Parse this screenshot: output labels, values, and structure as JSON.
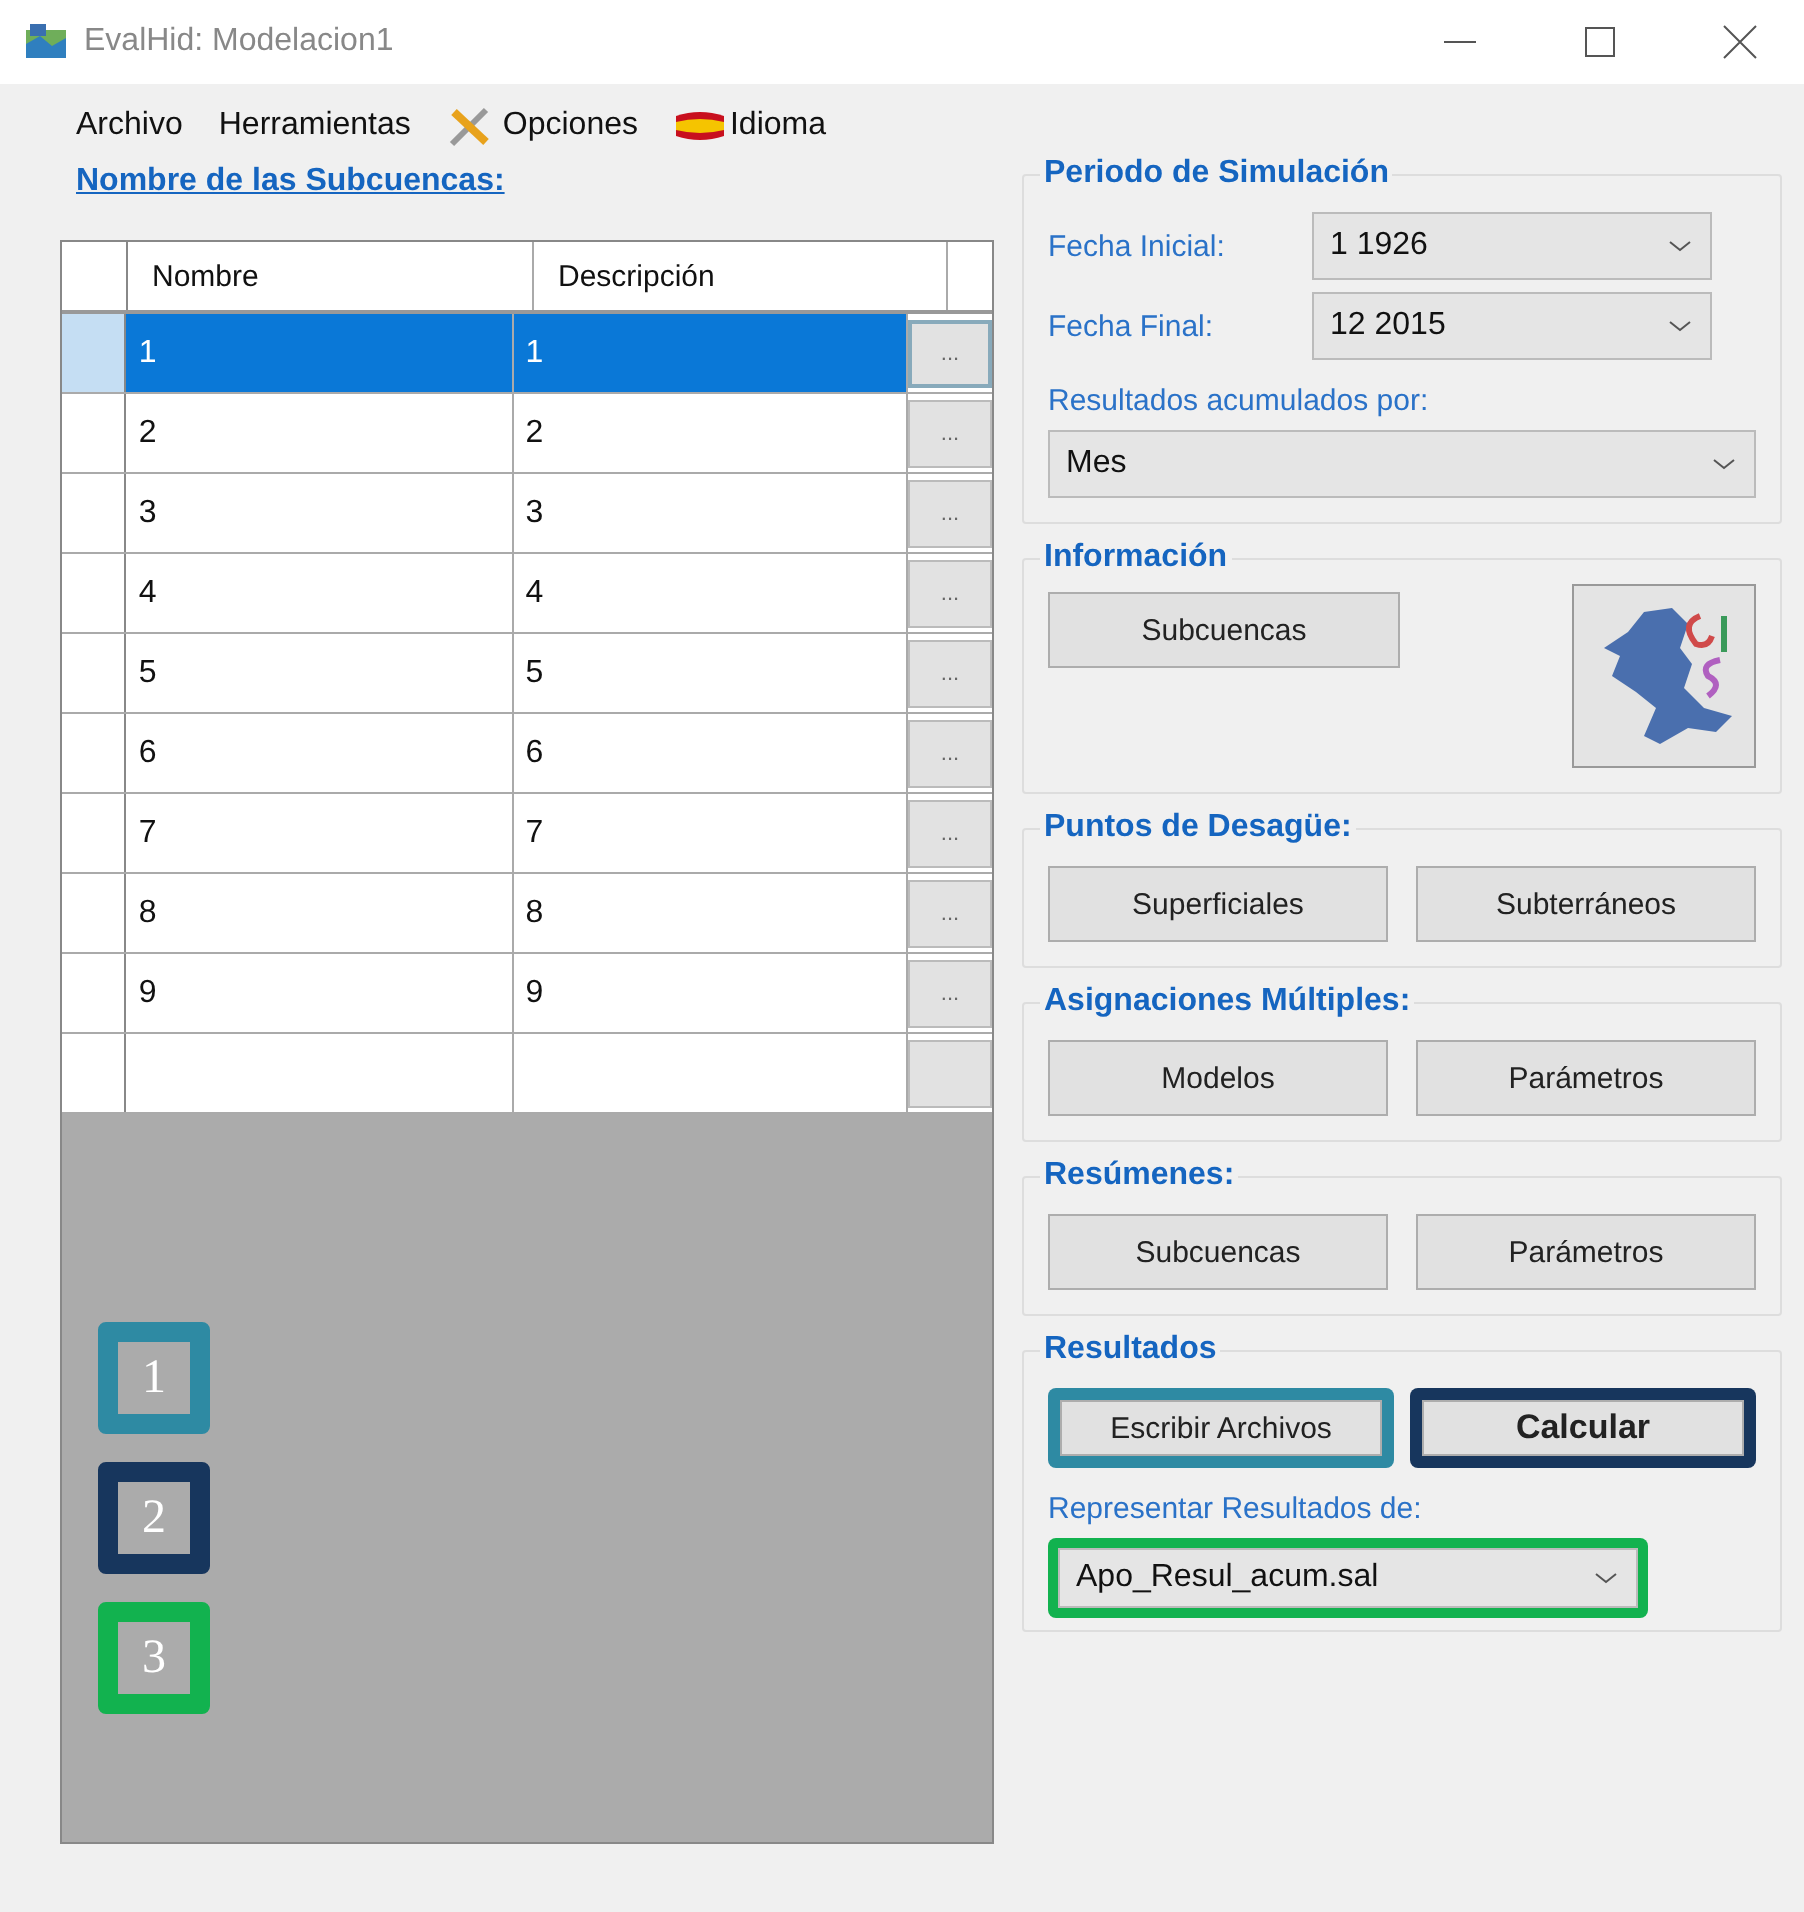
{
  "window": {
    "title": "EvalHid: Modelacion1"
  },
  "menu": [
    {
      "label": "Archivo",
      "kind": "plain"
    },
    {
      "label": "Herramientas",
      "kind": "plain"
    },
    {
      "label": "Opciones",
      "kind": "tools"
    },
    {
      "label": "Idioma",
      "kind": "flag"
    }
  ],
  "subbasins": {
    "title": "Nombre de las Subcuencas:",
    "columns": [
      "Nombre",
      "Descripción"
    ],
    "rows": [
      {
        "nombre": "1",
        "descripcion": "1",
        "selected": true,
        "button": "..."
      },
      {
        "nombre": "2",
        "descripcion": "2",
        "selected": false,
        "button": "..."
      },
      {
        "nombre": "3",
        "descripcion": "3",
        "selected": false,
        "button": "..."
      },
      {
        "nombre": "4",
        "descripcion": "4",
        "selected": false,
        "button": "..."
      },
      {
        "nombre": "5",
        "descripcion": "5",
        "selected": false,
        "button": "..."
      },
      {
        "nombre": "6",
        "descripcion": "6",
        "selected": false,
        "button": "..."
      },
      {
        "nombre": "7",
        "descripcion": "7",
        "selected": false,
        "button": "..."
      },
      {
        "nombre": "8",
        "descripcion": "8",
        "selected": false,
        "button": "..."
      },
      {
        "nombre": "9",
        "descripcion": "9",
        "selected": false,
        "button": "..."
      },
      {
        "nombre": "",
        "descripcion": "",
        "selected": false,
        "button": ""
      }
    ]
  },
  "callouts": [
    {
      "label": "1",
      "color": "#2e8aa3"
    },
    {
      "label": "2",
      "color": "#17365d"
    },
    {
      "label": "3",
      "color": "#12b24f"
    }
  ],
  "simulation": {
    "title": "Periodo de Simulación",
    "start_label": "Fecha Inicial:",
    "start_value": "1 1926",
    "end_label": "Fecha Final:",
    "end_value": "12 2015",
    "accum_label": "Resultados acumulados por:",
    "accum_value": "Mes"
  },
  "info": {
    "title": "Información",
    "buttons": [
      {
        "label": "Subcuencas"
      }
    ]
  },
  "outlets": {
    "title": "Puntos de Desagüe:",
    "buttons": [
      {
        "label": "Superficiales"
      },
      {
        "label": "Subterráneos"
      }
    ]
  },
  "assignments": {
    "title": "Asignaciones Múltiples:",
    "buttons": [
      {
        "label": "Modelos"
      },
      {
        "label": "Parámetros"
      }
    ]
  },
  "summaries": {
    "title": "Resúmenes:",
    "buttons": [
      {
        "label": "Subcuencas"
      },
      {
        "label": "Parámetros"
      }
    ]
  },
  "results": {
    "title": "Resultados",
    "buttons": [
      {
        "label": "Escribir Archivos",
        "bold": false,
        "color": "#2e8aa3"
      },
      {
        "label": "Calcular",
        "bold": true,
        "color": "#17365d"
      }
    ],
    "plot": {
      "label": "Representar Resultados de:",
      "value": "Apo_Resul_acum.sal",
      "color": "#12b24f"
    }
  }
}
